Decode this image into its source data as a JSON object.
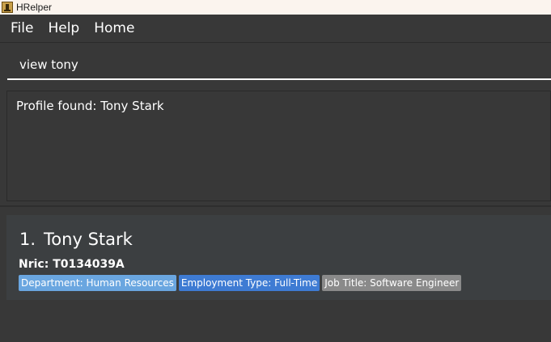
{
  "window": {
    "title": "HRelper",
    "icon": "app-icon"
  },
  "menu": {
    "items": [
      "File",
      "Help",
      "Home"
    ]
  },
  "command": {
    "value": "view tony"
  },
  "result": {
    "text": "Profile found: Tony Stark"
  },
  "persons": [
    {
      "index": "1.",
      "name": "Tony Stark",
      "nric": "Nric: T0134039A",
      "tags": {
        "department": "Department: Human Resources",
        "employment": "Employment Type: Full-Time",
        "job": "Job Title: Software Engineer"
      }
    }
  ],
  "colors": {
    "background": "#383838",
    "list_card": "#3c3f41",
    "tag_department": "#6aa6e0",
    "tag_employment": "#3e7bd3",
    "tag_job": "#8a8a8a"
  }
}
